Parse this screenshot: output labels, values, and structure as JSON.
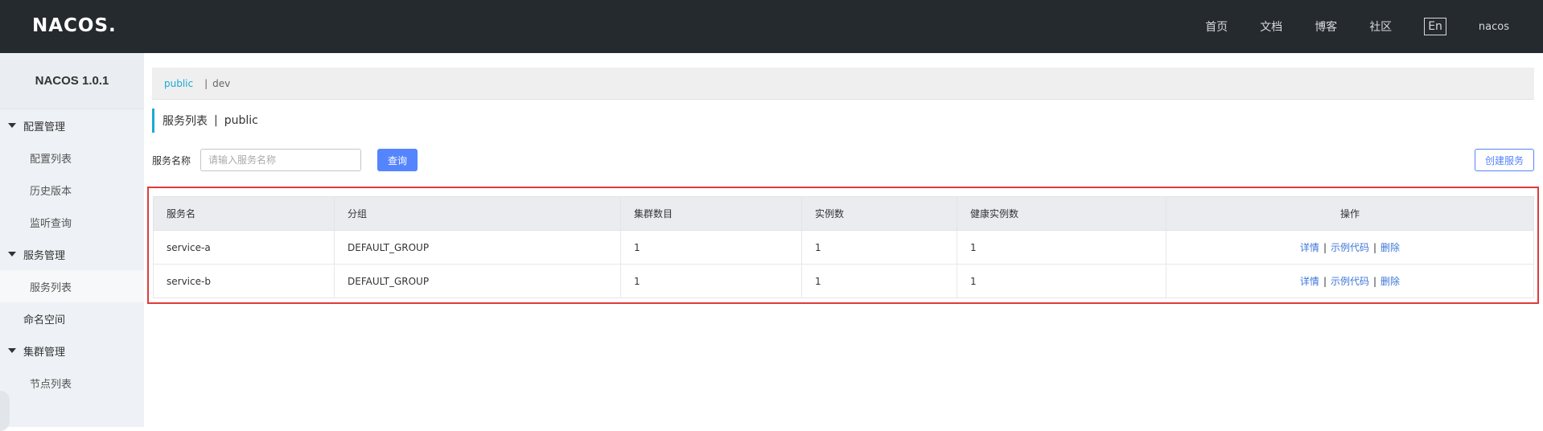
{
  "header": {
    "logo": "NACOS.",
    "nav": [
      "首页",
      "文档",
      "博客",
      "社区"
    ],
    "lang": "En",
    "user": "nacos"
  },
  "sidebar": {
    "brand": "NACOS 1.0.1",
    "groups": [
      {
        "label": "配置管理",
        "items": [
          "配置列表",
          "历史版本",
          "监听查询"
        ]
      },
      {
        "label": "服务管理",
        "items": [
          "服务列表"
        ]
      }
    ],
    "namespace_item": "命名空间",
    "cluster_group": {
      "label": "集群管理",
      "items": [
        "节点列表"
      ]
    }
  },
  "namespaces": {
    "active": "public",
    "other": "dev",
    "separator": "|"
  },
  "page_title": {
    "title": "服务列表",
    "separator": "|",
    "namespace": "public"
  },
  "search": {
    "label": "服务名称",
    "placeholder": "请输入服务名称",
    "query_button": "查询",
    "create_button": "创建服务"
  },
  "table": {
    "columns": [
      "服务名",
      "分组",
      "集群数目",
      "实例数",
      "健康实例数",
      "操作"
    ],
    "rows": [
      {
        "name": "service-a",
        "group": "DEFAULT_GROUP",
        "clusters": "1",
        "instances": "1",
        "healthy": "1"
      },
      {
        "name": "service-b",
        "group": "DEFAULT_GROUP",
        "clusters": "1",
        "instances": "1",
        "healthy": "1"
      }
    ],
    "ops": {
      "detail": "详情",
      "sample": "示例代码",
      "delete": "删除",
      "sep": "|"
    }
  },
  "colors": {
    "topbar": "#252a2f",
    "accent": "#1ba9d4",
    "primary": "#5584ff",
    "highlight": "#e03a3a"
  }
}
